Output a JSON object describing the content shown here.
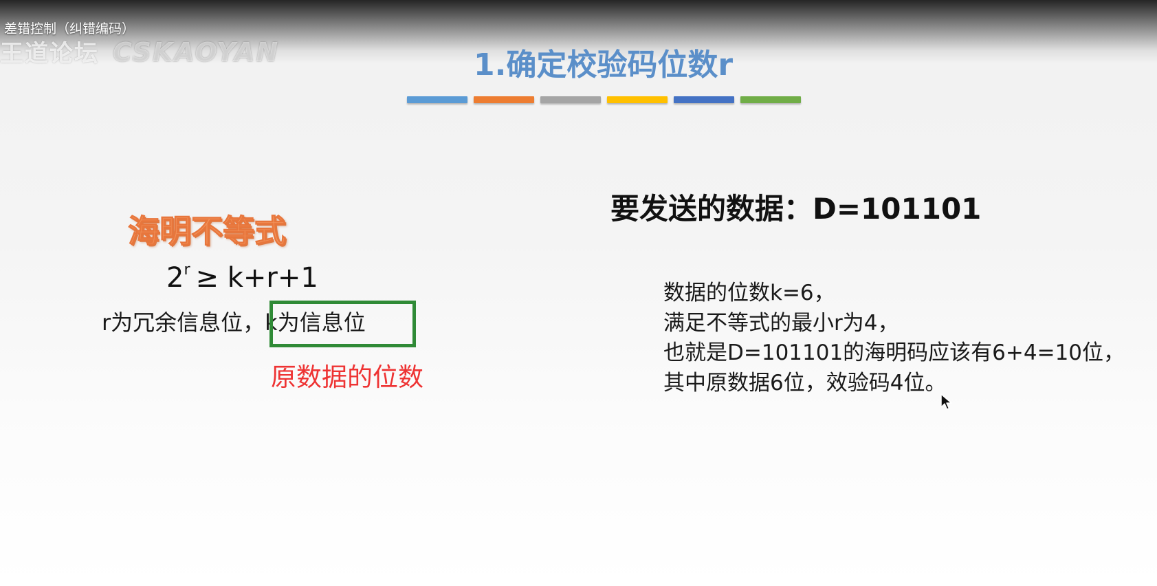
{
  "video": {
    "title": "差错控制（纠错编码）",
    "watermark_text": "王道论坛",
    "watermark_logo": "CSKAOYAN"
  },
  "slide": {
    "title": "1.确定校验码位数r",
    "accent_bar_colors": [
      "#5b9bd5",
      "#ed7d31",
      "#a5a5a5",
      "#ffc000",
      "#4472c4",
      "#70ad47"
    ]
  },
  "left_panel": {
    "heading": "海明不等式",
    "formula_base": "2",
    "formula_exponent": "r",
    "formula_rest": "≥ k+r+1",
    "definition_prefix": "r为冗余信息位，",
    "definition_highlight": "k为信息位",
    "highlight_note": "原数据的位数",
    "highlight_border_color": "#2f8a36",
    "note_color": "#ee3333"
  },
  "right_panel": {
    "send_data": "要发送的数据：D=101101",
    "explanation_lines": [
      "数据的位数k=6，",
      "满足不等式的最小r为4，",
      "也就是D=101101的海明码应该有6+4=10位，",
      "其中原数据6位，效验码4位。"
    ]
  }
}
